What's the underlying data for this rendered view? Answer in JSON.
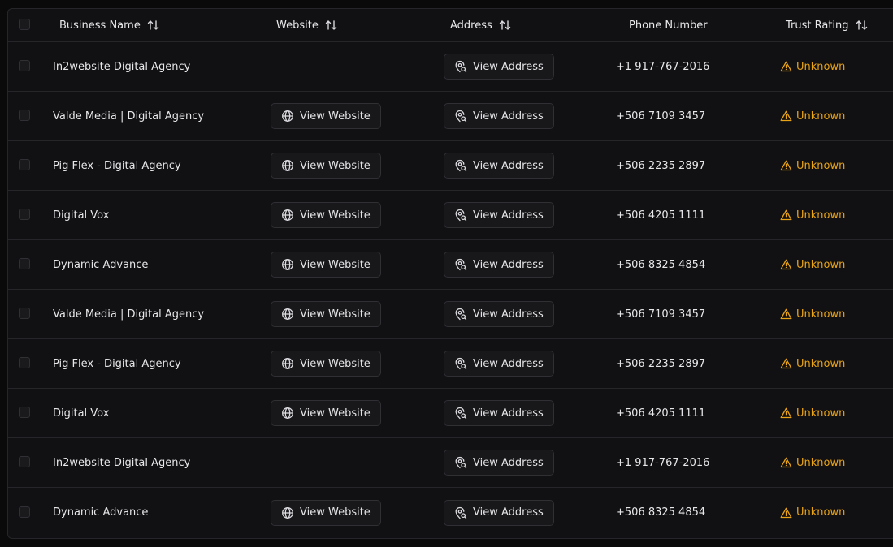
{
  "columns": {
    "business_name": "Business Name",
    "website": "Website",
    "address": "Address",
    "phone": "Phone Number",
    "trust_rating": "Trust Rating"
  },
  "icons": {
    "sort": "sort-arrows-icon",
    "website": "globe-icon",
    "address": "map-pin-search-icon",
    "trust": "warning-triangle-icon"
  },
  "colors": {
    "warning": "#e8a317"
  },
  "rows": [
    {
      "name": "In2website Digital Agency",
      "website_label": "",
      "address_label": "View Address",
      "phone": "+1 917-767-2016",
      "trust": "Unknown"
    },
    {
      "name": "Valde Media | Digital Agency",
      "website_label": "View Website",
      "address_label": "View Address",
      "phone": "+506 7109 3457",
      "trust": "Unknown"
    },
    {
      "name": "Pig Flex - Digital Agency",
      "website_label": "View Website",
      "address_label": "View Address",
      "phone": "+506 2235 2897",
      "trust": "Unknown"
    },
    {
      "name": "Digital Vox",
      "website_label": "View Website",
      "address_label": "View Address",
      "phone": "+506 4205 1111",
      "trust": "Unknown"
    },
    {
      "name": "Dynamic Advance",
      "website_label": "View Website",
      "address_label": "View Address",
      "phone": "+506 8325 4854",
      "trust": "Unknown"
    },
    {
      "name": "Valde Media | Digital Agency",
      "website_label": "View Website",
      "address_label": "View Address",
      "phone": "+506 7109 3457",
      "trust": "Unknown"
    },
    {
      "name": "Pig Flex - Digital Agency",
      "website_label": "View Website",
      "address_label": "View Address",
      "phone": "+506 2235 2897",
      "trust": "Unknown"
    },
    {
      "name": "Digital Vox",
      "website_label": "View Website",
      "address_label": "View Address",
      "phone": "+506 4205 1111",
      "trust": "Unknown"
    },
    {
      "name": "In2website Digital Agency",
      "website_label": "",
      "address_label": "View Address",
      "phone": "+1 917-767-2016",
      "trust": "Unknown"
    },
    {
      "name": "Dynamic Advance",
      "website_label": "View Website",
      "address_label": "View Address",
      "phone": "+506 8325 4854",
      "trust": "Unknown"
    }
  ]
}
